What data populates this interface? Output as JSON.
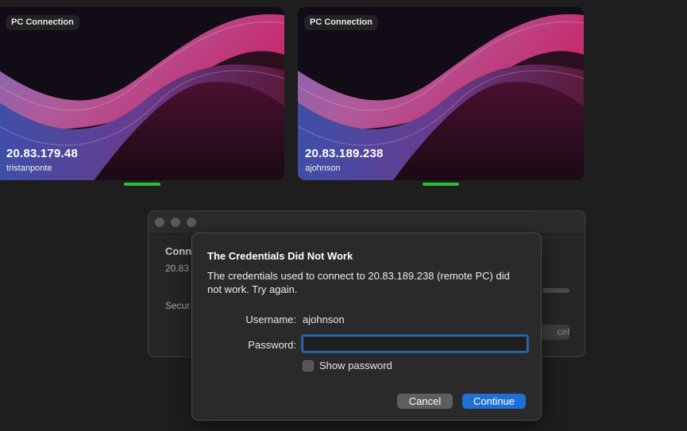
{
  "tiles": [
    {
      "badge": "PC Connection",
      "ip": "20.83.179.48",
      "user": "tristanponte"
    },
    {
      "badge": "PC Connection",
      "ip": "20.83.189.238",
      "user": "ajohnson"
    }
  ],
  "background_window": {
    "heading_partial": "Conn",
    "subtitle_partial": "20.83",
    "security_partial": "Secur",
    "button_partial": "cel"
  },
  "dialog": {
    "title": "The Credentials Did Not Work",
    "message": "The credentials used to connect to 20.83.189.238 (remote PC) did not work. Try again.",
    "username_label": "Username:",
    "username_value": "ajohnson",
    "password_label": "Password:",
    "password_value": "",
    "show_password_label": "Show password",
    "cancel_label": "Cancel",
    "continue_label": "Continue"
  },
  "colors": {
    "background": "#1e1e1e",
    "accent": "#1f6fd6",
    "connected_indicator": "#2bbf33"
  },
  "icons": [
    "close-traffic-light-icon",
    "minimize-traffic-light-icon",
    "zoom-traffic-light-icon",
    "checkbox-icon"
  ]
}
